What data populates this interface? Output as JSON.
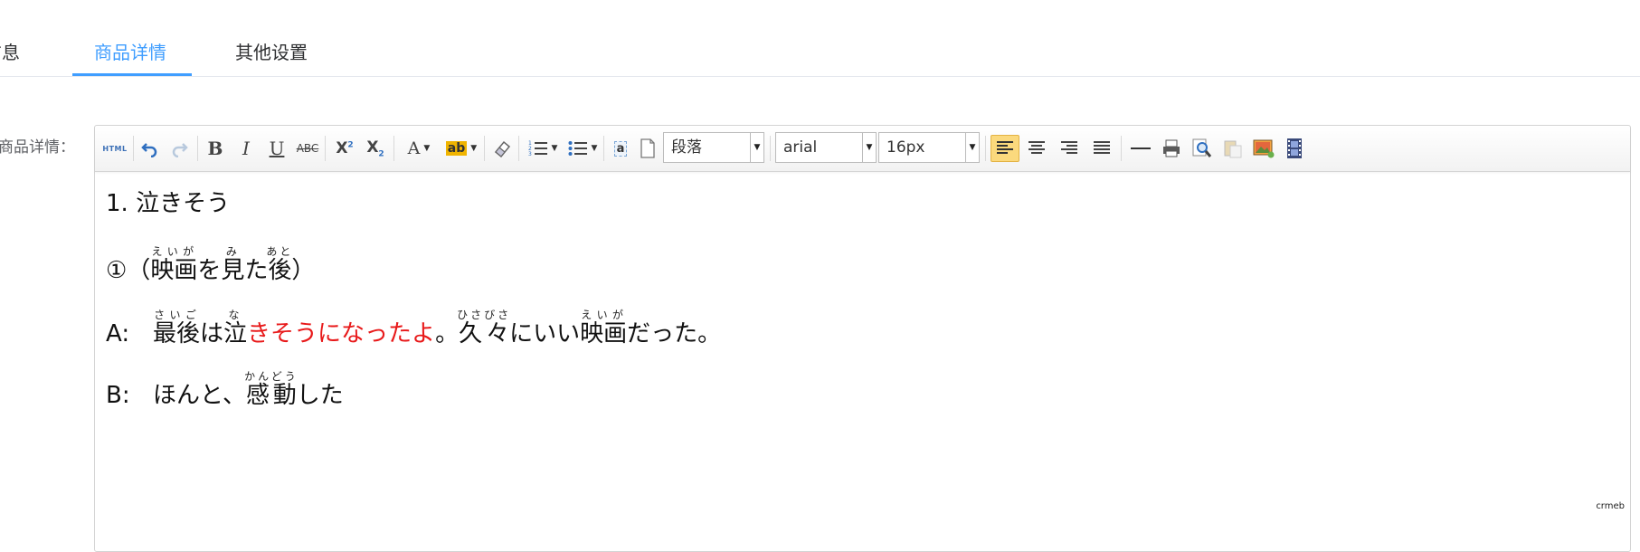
{
  "tabs": [
    {
      "label": "信息"
    },
    {
      "label": "商品详情"
    },
    {
      "label": "其他设置"
    }
  ],
  "form": {
    "label": "商品详情："
  },
  "toolbar": {
    "html_label": "HTML",
    "paragraph_select": "段落",
    "font_family_select": "arial",
    "font_size_select": "16px",
    "icons": [
      "html-icon",
      "undo-icon",
      "redo-icon",
      "bold-icon",
      "italic-icon",
      "underline-icon",
      "strikethrough-icon",
      "superscript-icon",
      "subscript-icon",
      "font-color-icon",
      "highlight-icon",
      "eraser-icon",
      "ordered-list-icon",
      "unordered-list-icon",
      "anchor-icon",
      "page-icon",
      "align-left-icon",
      "align-center-icon",
      "align-right-icon",
      "align-justify-icon",
      "horizontal-rule-icon",
      "print-icon",
      "preview-icon",
      "paste-icon",
      "image-icon",
      "video-icon"
    ]
  },
  "content": {
    "line1": "1. 泣きそう",
    "line2": {
      "prefix": "①（",
      "w1": "映画",
      "w1_rt": "えいが",
      "w2": "を",
      "w3": "見",
      "w3_rt": "み",
      "w4": "た",
      "w5": "後",
      "w5_rt": "あと",
      "suffix": "）"
    },
    "line3": {
      "speaker": "A:",
      "w1": "最後",
      "w1_rt": "さいご",
      "w2": "は",
      "w3": "泣",
      "w3_rt": "な",
      "red": "きそうになったよ",
      "w4": "。",
      "w5": "久々",
      "w5_rt": "ひさびさ",
      "w6": "にいい",
      "w7": "映画",
      "w7_rt": "えいが",
      "w8": "だった。"
    },
    "line4": {
      "speaker": "B:",
      "w1": "ほんと、",
      "w2": "感動",
      "w2_rt": "かんどう",
      "w3": "した"
    }
  },
  "watermark": "crmeb",
  "colors": {
    "accent": "#409eff",
    "highlight_text": "#e8191a",
    "active_button": "#fbd97d"
  }
}
